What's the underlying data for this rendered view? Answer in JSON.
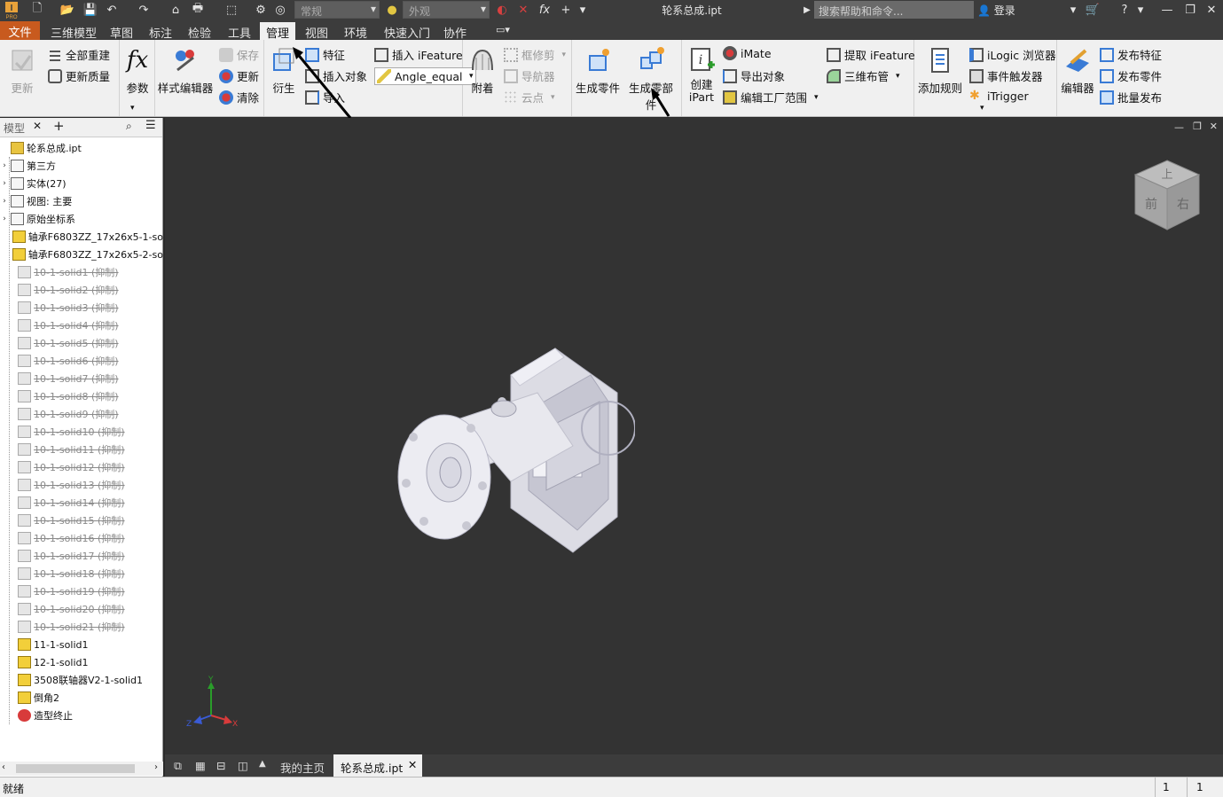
{
  "quick_access": {
    "style_dropdown": "常规",
    "material_dropdown": "外观",
    "title": "轮系总成.ipt",
    "search_placeholder": "搜索帮助和命令...",
    "login": "登录"
  },
  "tabs": [
    "文件",
    "三维模型",
    "草图",
    "标注",
    "检验",
    "工具",
    "管理",
    "视图",
    "环境",
    "快速入门",
    "协作"
  ],
  "ribbon": {
    "update": {
      "update_big": "更新",
      "rebuild_all": "全部重建",
      "update_mass": "更新质量"
    },
    "params": {
      "params": "参数"
    },
    "styles": {
      "style_editor": "样式编辑器",
      "save": "保存",
      "update": "更新",
      "purge": "清除"
    },
    "insert": {
      "derive": "衍生",
      "feature": "特征",
      "insert_object": "插入对象",
      "import": "导入",
      "insert_ifeature": "插入 iFeature",
      "angle_equal": "Angle_equal"
    },
    "attach": {
      "attach": "附着",
      "frame_trim": "框修剪",
      "navigator": "导航器",
      "point_cloud": "云点"
    },
    "layout": {
      "make_part": "生成零件",
      "make_components": "生成零部件"
    },
    "author": {
      "create_ipart": "创建",
      "ipart": "iPart",
      "imate": "iMate",
      "export_object": "导出对象",
      "edit_factory": "编辑工厂范围",
      "extract_ifeature": "提取 iFeature",
      "piping": "三维布管"
    },
    "ilogic": {
      "add_rule": "添加规则",
      "browser": "iLogic 浏览器",
      "event_trigger": "事件触发器",
      "itrigger": "iTrigger"
    },
    "content": {
      "editor": "编辑器",
      "publish_feature": "发布特征",
      "publish_part": "发布零件",
      "batch_publish": "批量发布"
    }
  },
  "panel": {
    "title": "模型",
    "tree": [
      {
        "label": "轮系总成.ipt",
        "type": "root",
        "suppressed": false
      },
      {
        "label": "第三方",
        "type": "folder",
        "suppressed": false
      },
      {
        "label": "实体(27)",
        "type": "folder",
        "suppressed": false
      },
      {
        "label": "视图: 主要",
        "type": "folder",
        "suppressed": false
      },
      {
        "label": "原始坐标系",
        "type": "folder",
        "suppressed": false
      },
      {
        "label": "轴承F6803ZZ_17x26x5-1-so",
        "type": "solid",
        "suppressed": false
      },
      {
        "label": "轴承F6803ZZ_17x26x5-2-so",
        "type": "solid",
        "suppressed": false
      },
      {
        "label": "10-1-solid1 (抑制)",
        "type": "solid",
        "suppressed": true
      },
      {
        "label": "10-1-solid2 (抑制)",
        "type": "solid",
        "suppressed": true
      },
      {
        "label": "10-1-solid3 (抑制)",
        "type": "solid",
        "suppressed": true
      },
      {
        "label": "10-1-solid4 (抑制)",
        "type": "solid",
        "suppressed": true
      },
      {
        "label": "10-1-solid5 (抑制)",
        "type": "solid",
        "suppressed": true
      },
      {
        "label": "10-1-solid6 (抑制)",
        "type": "solid",
        "suppressed": true
      },
      {
        "label": "10-1-solid7 (抑制)",
        "type": "solid",
        "suppressed": true
      },
      {
        "label": "10-1-solid8 (抑制)",
        "type": "solid",
        "suppressed": true
      },
      {
        "label": "10-1-solid9 (抑制)",
        "type": "solid",
        "suppressed": true
      },
      {
        "label": "10-1-solid10 (抑制)",
        "type": "solid",
        "suppressed": true
      },
      {
        "label": "10-1-solid11 (抑制)",
        "type": "solid",
        "suppressed": true
      },
      {
        "label": "10-1-solid12 (抑制)",
        "type": "solid",
        "suppressed": true
      },
      {
        "label": "10-1-solid13 (抑制)",
        "type": "solid",
        "suppressed": true
      },
      {
        "label": "10-1-solid14 (抑制)",
        "type": "solid",
        "suppressed": true
      },
      {
        "label": "10-1-solid15 (抑制)",
        "type": "solid",
        "suppressed": true
      },
      {
        "label": "10-1-solid16 (抑制)",
        "type": "solid",
        "suppressed": true
      },
      {
        "label": "10-1-solid17 (抑制)",
        "type": "solid",
        "suppressed": true
      },
      {
        "label": "10-1-solid18 (抑制)",
        "type": "solid",
        "suppressed": true
      },
      {
        "label": "10-1-solid19 (抑制)",
        "type": "solid",
        "suppressed": true
      },
      {
        "label": "10-1-solid20 (抑制)",
        "type": "solid",
        "suppressed": true
      },
      {
        "label": "10-1-solid21 (抑制)",
        "type": "solid",
        "suppressed": true
      },
      {
        "label": "11-1-solid1",
        "type": "solid",
        "suppressed": false
      },
      {
        "label": "12-1-solid1",
        "type": "solid",
        "suppressed": false
      },
      {
        "label": "3508联轴器V2-1-solid1",
        "type": "solid",
        "suppressed": false
      },
      {
        "label": "倒角2",
        "type": "solid",
        "suppressed": false
      },
      {
        "label": "造型终止",
        "type": "end",
        "suppressed": false
      }
    ]
  },
  "doc_tabs": {
    "home": "我的主页",
    "file": "轮系总成.ipt"
  },
  "status": {
    "text": "就绪",
    "count1": "1",
    "count2": "1"
  },
  "viewcube": {
    "top": "上",
    "front": "前",
    "right": "右"
  },
  "axes": {
    "x": "X",
    "y": "Y",
    "z": "Z"
  },
  "colors": {
    "file_tab": "#c85a1e",
    "viewport": "#333333",
    "active_tab": "#f0f0f0"
  }
}
